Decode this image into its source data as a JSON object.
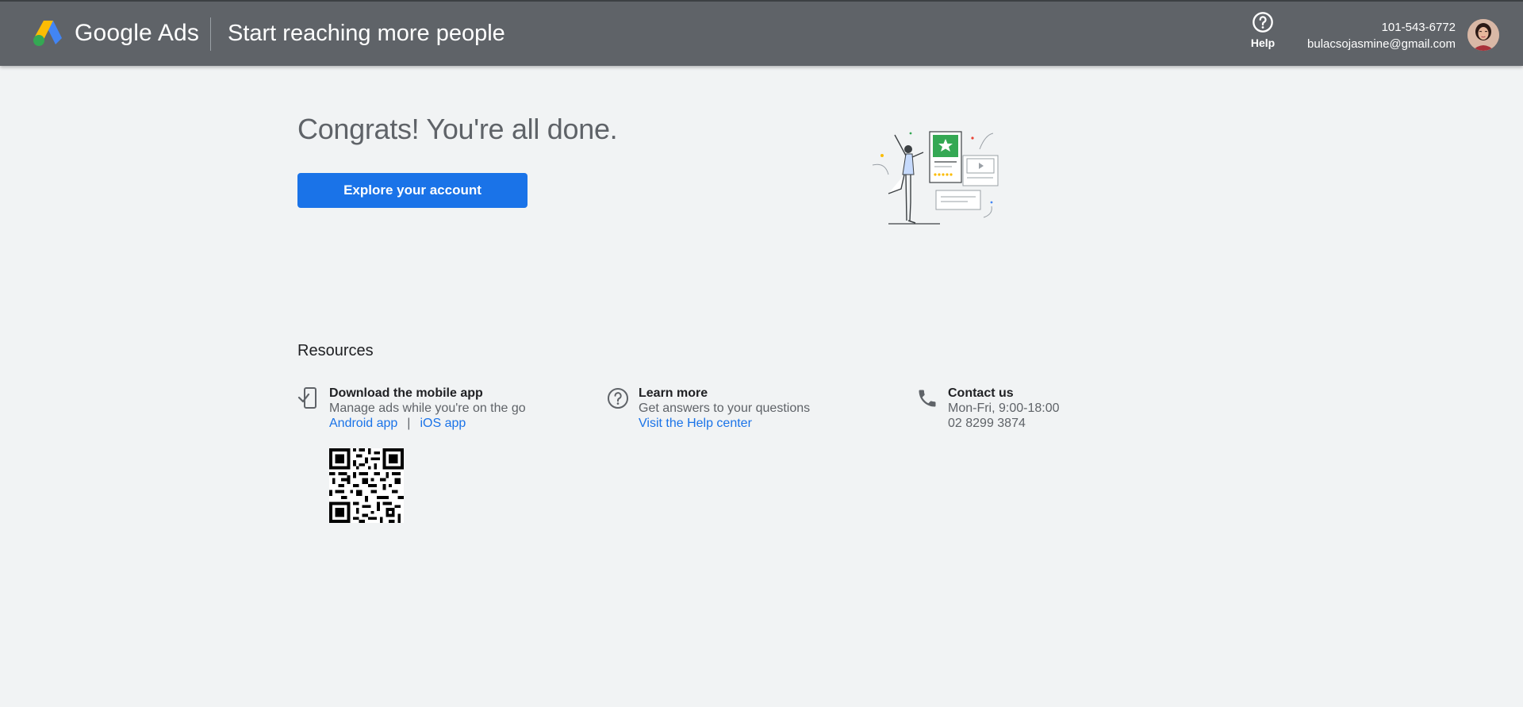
{
  "header": {
    "brand": "Google Ads",
    "title": "Start reaching more people",
    "help_label": "Help",
    "account_id": "101-543-6772",
    "email": "bulacsojasmine@gmail.com"
  },
  "main": {
    "headline": "Congrats! You're all done.",
    "explore_label": "Explore your account"
  },
  "resources": {
    "title": "Resources",
    "mobile": {
      "heading": "Download the mobile app",
      "subtitle": "Manage ads while you're on the go",
      "android_label": "Android app",
      "separator": "|",
      "ios_label": "iOS app"
    },
    "learn": {
      "heading": "Learn more",
      "subtitle": "Get answers to your questions",
      "link_label": "Visit the Help center"
    },
    "contact": {
      "heading": "Contact us",
      "hours": "Mon-Fri, 9:00-18:00",
      "phone": "02 8299 3874"
    }
  },
  "icons": {
    "logo": "google-ads-logo",
    "help": "help-circle-icon",
    "mobile": "phone-check-icon",
    "learn": "help-outline-icon",
    "contact": "phone-icon"
  },
  "colors": {
    "header_bg": "#5f6368",
    "page_bg": "#f1f3f4",
    "accent": "#1a73e8",
    "illustration_green": "#34a853"
  }
}
